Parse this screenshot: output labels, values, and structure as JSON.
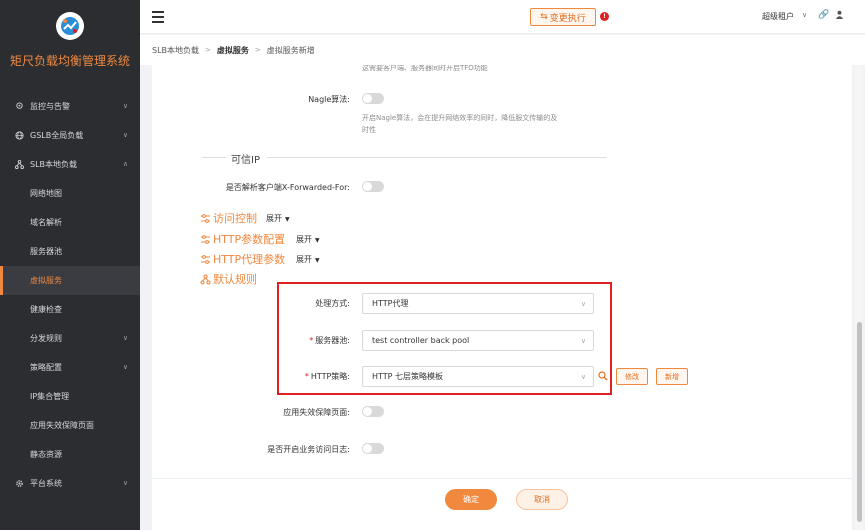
{
  "sidebar": {
    "title": "矩尺负载均衡管理系统",
    "items": [
      {
        "label": "监控与告警",
        "icon": "location-icon",
        "chevron": "∨"
      },
      {
        "label": "GSLB全局负载",
        "icon": "globe-icon",
        "chevron": "∨"
      },
      {
        "label": "SLB本地负载",
        "icon": "network-icon",
        "chevron": "∧"
      },
      {
        "label": "网络地图"
      },
      {
        "label": "域名解析"
      },
      {
        "label": "服务器池"
      },
      {
        "label": "虚拟服务",
        "active": true
      },
      {
        "label": "健康检查"
      },
      {
        "label": "分发规则",
        "chevron": "∨"
      },
      {
        "label": "策略配置",
        "chevron": "∨"
      },
      {
        "label": "IP集合管理"
      },
      {
        "label": "应用失效保障页面"
      },
      {
        "label": "静态资源"
      },
      {
        "label": "平台系统",
        "icon": "gear-icon",
        "chevron": "∨"
      }
    ]
  },
  "header": {
    "change_button": "变更执行",
    "alert_badge": "!",
    "user": "超级租户"
  },
  "breadcrumb": [
    "SLB本地负载",
    "虚拟服务",
    "虚拟服务新增"
  ],
  "form": {
    "top_help": "这需要客户端、服务器同时开启TFO功能",
    "nagle_label": "Nagle算法:",
    "nagle_help_line1": "开启Nagle算法，会在提升网络效率的同时，降低服文传输的及",
    "nagle_help_line2": "时性",
    "trusted_ip_section": "可信IP",
    "xff_label": "是否解析客户端X-Forwarded-For:",
    "groups": [
      {
        "title": "访问控制",
        "expand": "展开"
      },
      {
        "title": "HTTP参数配置",
        "expand": "展开"
      },
      {
        "title": "HTTP代理参数",
        "expand": "展开"
      },
      {
        "title": "默认规则"
      }
    ],
    "processing_label": "处理方式:",
    "processing_value": "HTTP代理",
    "pool_label": "服务器池:",
    "pool_value": "test controller back pool",
    "policy_label": "HTTP策略:",
    "policy_value": "HTTP 七层策略模板",
    "modify_button": "修改",
    "add_button": "新增",
    "fail_page_label": "应用失效保障页面:",
    "access_log_label": "是否开启业务访问日志:"
  },
  "footer": {
    "ok": "确定",
    "cancel": "取消"
  },
  "colors": {
    "accent": "#f0883e",
    "sidebar_bg": "#2b2d31",
    "highlight": "#e02020"
  }
}
